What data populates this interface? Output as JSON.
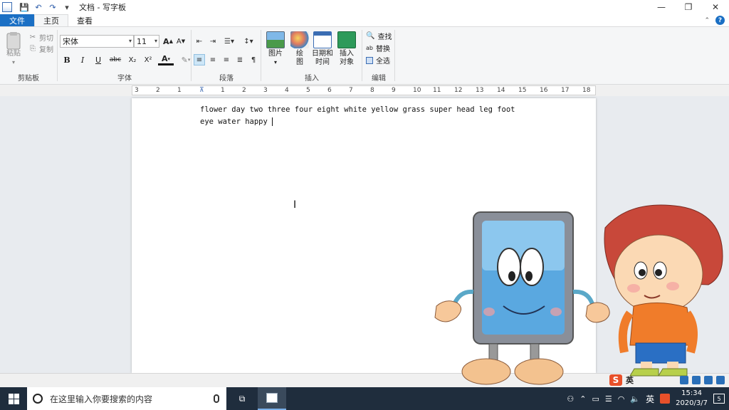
{
  "window": {
    "title": "文档 - 写字板",
    "controls": {
      "minimize": "—",
      "maximize": "❐",
      "close": "✕"
    }
  },
  "quick_access": {
    "save": "💾",
    "undo": "↶",
    "redo": "↷",
    "customize": "▾"
  },
  "tabs": {
    "file": "文件",
    "home": "主页",
    "view": "查看"
  },
  "ribbon": {
    "clipboard": {
      "label": "剪贴板",
      "paste": "粘贴",
      "cut": "剪切",
      "copy": "复制"
    },
    "font": {
      "label": "字体",
      "family": "宋体",
      "size": "11",
      "grow": "A",
      "shrink": "A",
      "bold": "B",
      "italic": "I",
      "underline": "U",
      "strike": "abc",
      "subscript": "X₂",
      "superscript": "X²",
      "color": "A",
      "highlight": "✎"
    },
    "paragraph": {
      "label": "段落"
    },
    "insert": {
      "label": "插入",
      "picture": "图片",
      "paint": "绘\n图",
      "datetime": "日期和\n时间",
      "object": "插入\n对象"
    },
    "editing": {
      "label": "编辑",
      "find": "查找",
      "replace": "替换",
      "select_all": "全选"
    }
  },
  "ruler": {
    "ticks": [
      "3",
      "2",
      "1",
      "1",
      "2",
      "3",
      "4",
      "5",
      "6",
      "7",
      "8",
      "9",
      "10",
      "11",
      "12",
      "13",
      "14",
      "15",
      "16",
      "17",
      "18"
    ]
  },
  "document": {
    "text": "flower day two three four eight white yellow grass super head leg foot eye water happy "
  },
  "taskbar": {
    "search_placeholder": "在这里输入你要搜索的内容",
    "ime_lang": "英",
    "time": "15:34",
    "date": "2020/3/7",
    "notifications": "5"
  },
  "ime_bar": {
    "logo": "S",
    "mode": "英"
  }
}
